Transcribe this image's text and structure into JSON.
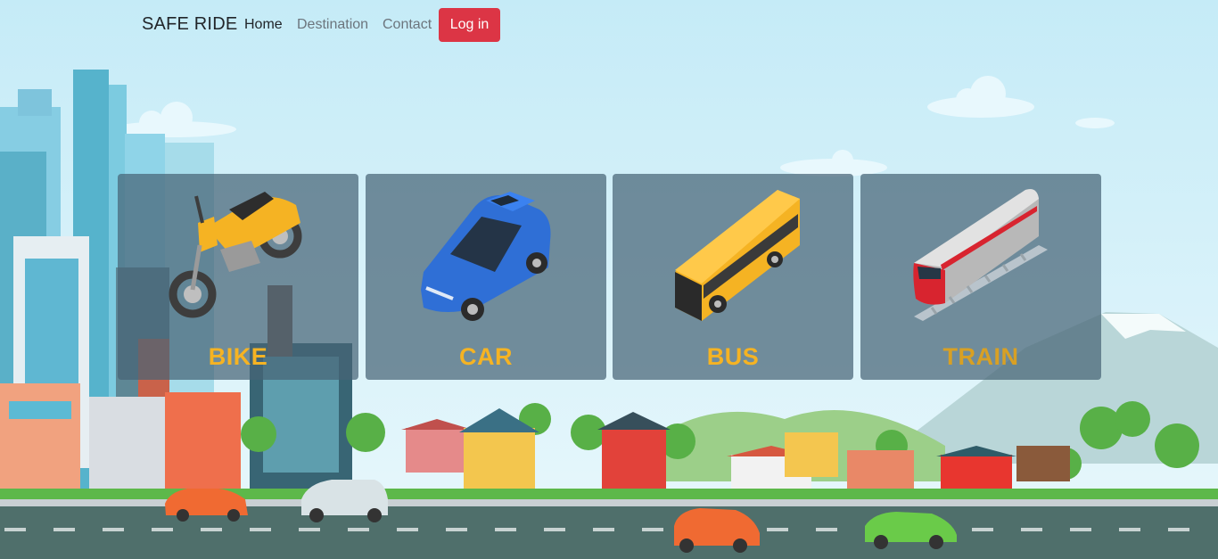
{
  "navbar": {
    "brand": "SAFE RIDE",
    "links": [
      {
        "label": "Home",
        "active": true
      },
      {
        "label": "Destination",
        "active": false
      },
      {
        "label": "Contact",
        "active": false
      }
    ],
    "login_label": "Log in"
  },
  "vehicles": [
    {
      "label": "BIKE",
      "icon": "motorbike-icon"
    },
    {
      "label": "CAR",
      "icon": "car-icon"
    },
    {
      "label": "BUS",
      "icon": "bus-icon"
    },
    {
      "label": "TRAIN",
      "icon": "train-icon"
    }
  ],
  "colors": {
    "accent": "#dc3545",
    "card_label": "#f5b323",
    "card_bg": "#466476"
  }
}
